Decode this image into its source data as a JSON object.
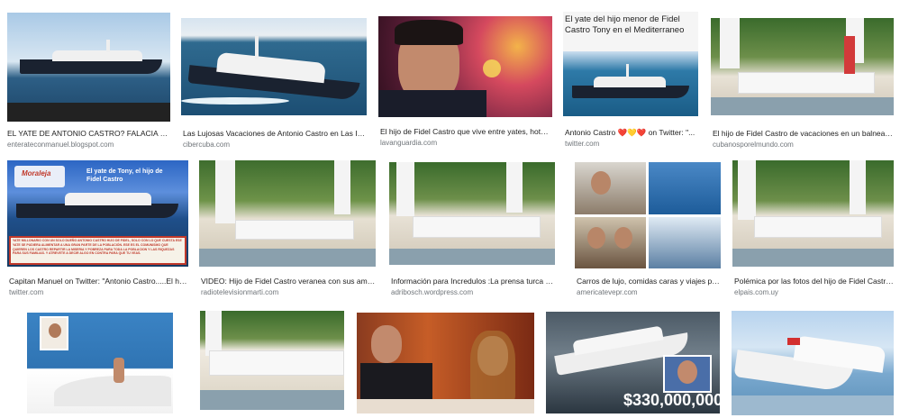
{
  "results": [
    {
      "caption": "EL YATE DE ANTONIO CASTRO? FALACIA NOT...",
      "source": "enterateconmanuel.blogspot.com"
    },
    {
      "caption": "Las Lujosas Vacaciones de Antonio Castro en Las Isl...",
      "source": "cibercuba.com"
    },
    {
      "caption": "El hijo de Fidel Castro que vive entre yates, hotele...",
      "source": "lavanguardia.com"
    },
    {
      "caption": "Antonio Castro ❤️💛❤️ on Twitter: \"...",
      "source": "twitter.com",
      "overlay": "El yate del hijo menor de Fidel Castro Tony en el Mediterraneo"
    },
    {
      "caption": "El hijo de Fidel Castro de vacaciones en un balneario...",
      "source": "cubanosporelmundo.com"
    },
    {
      "caption": "Capitan Manuel on Twitter: \"Antonio Castro.....El hij...",
      "source": "twitter.com",
      "overlay_title": "El yate de Tony, el hijo de Fidel Castro",
      "overlay_logo": "Moraleja",
      "overlay_body": "YATE MILLONARIO CON UN SOLO DUEÑO ANTONIO CASTRO HIJO DE FIDEL, SOLO CON LO QUE CUESTA ESE YATE SE PUDIERA ALIMENTAR A UNA GRAN PARTE DE LA POBLACIÓN. ESE ES EL COMUNISMO QUE QUIEREN LOS CASTRO REPARTIR LA MISERIA Y POBREZA PARA TODA LA POBLACION Y LAS RIQUEZAS PARA SUS FAMILIAS. Y ATREVETE A DECIR ALGO EN CONTRA PARA QUE TU VEAS."
    },
    {
      "caption": "VIDEO: Hijo de Fidel Castro veranea con sus amigo...",
      "source": "radiotelevisionmarti.com"
    },
    {
      "caption": "Información para Incredulos :La prensa turca pub...",
      "source": "adribosch.wordpress.com"
    },
    {
      "caption": "Carros de lujo, comidas caras y viajes por...",
      "source": "americatevepr.com"
    },
    {
      "caption": "Polémica por las fotos del hijo de Fidel Castro...",
      "source": "elpais.com.uy"
    },
    {
      "caption": "",
      "source": ""
    },
    {
      "caption": "",
      "source": ""
    },
    {
      "caption": "",
      "source": ""
    },
    {
      "caption": "",
      "source": "",
      "overlay": "$330,000,000"
    },
    {
      "caption": "",
      "source": ""
    }
  ],
  "colors": {
    "sea": "#1d5f8a",
    "sky": "#b9d3ea",
    "hull": "#1a2230"
  }
}
